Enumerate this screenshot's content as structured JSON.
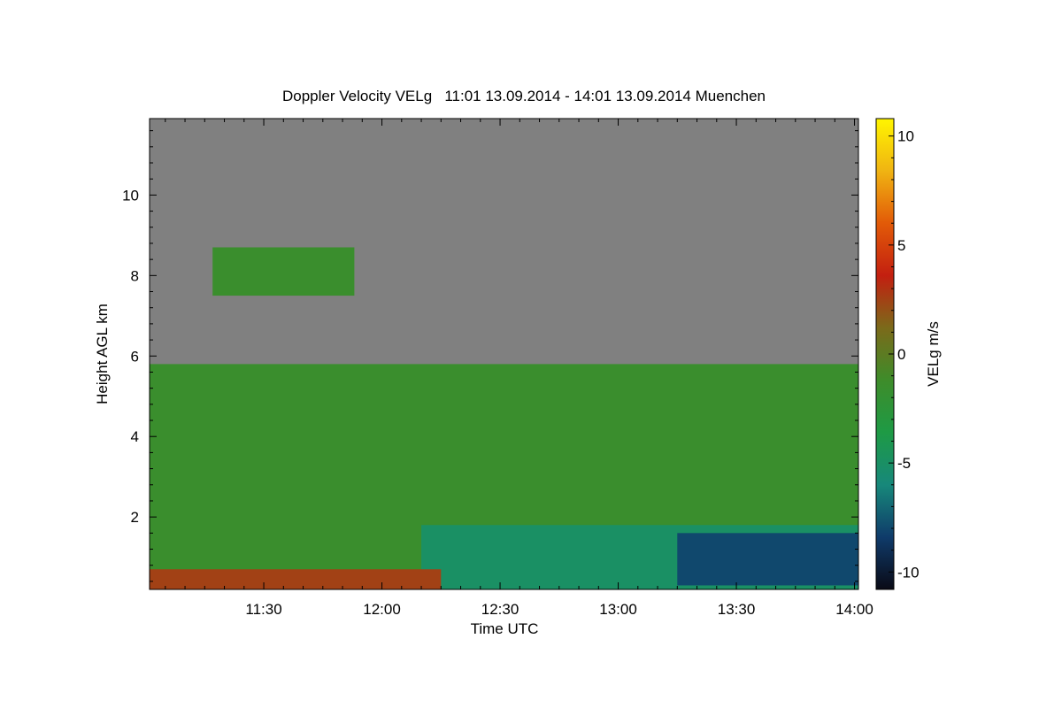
{
  "chart_data": {
    "type": "heatmap",
    "title": "Doppler Velocity VELg   11:01 13.09.2014 - 14:01 13.09.2014 Muenchen",
    "xlabel": "Time UTC",
    "ylabel": "Height AGL km",
    "colorbar_label": "VELg m/s",
    "x_range": [
      "11:01",
      "14:01"
    ],
    "x_ticks": [
      "11:30",
      "12:00",
      "12:30",
      "13:00",
      "13:30",
      "14:00"
    ],
    "y_range_km": [
      0.2,
      11.9
    ],
    "y_ticks": [
      2,
      4,
      6,
      8,
      10
    ],
    "colorbar_range": [
      -10.8,
      10.8
    ],
    "colorbar_ticks": [
      10,
      5,
      0,
      -5,
      -10
    ],
    "colorscale": [
      "#0a0a16",
      "#0f3b6a",
      "#17887a",
      "#1e9a45",
      "#3e8c2a",
      "#7b6a1a",
      "#c31f10",
      "#e25a08",
      "#f0b412",
      "#fff500"
    ],
    "background_color": "#808080",
    "features": [
      {
        "description": "main cloud/precipitation layer",
        "time_start": "11:01",
        "time_end": "14:01",
        "height_base_km": 0.2,
        "height_top_km": 5.8,
        "velocity_ms": -1.5
      },
      {
        "description": "elevated cloud patch",
        "time_start": "11:17",
        "time_end": "11:53",
        "height_base_km": 7.5,
        "height_top_km": 8.7,
        "velocity_ms": -1.5
      },
      {
        "description": "fast downward motion below melting layer",
        "time_start": "12:10",
        "time_end": "14:01",
        "height_base_km": 0.2,
        "height_top_km": 1.8,
        "velocity_ms": -5.0
      },
      {
        "description": "strongest downward motion",
        "time_start": "13:15",
        "time_end": "14:01",
        "height_base_km": 0.3,
        "height_top_km": 1.6,
        "velocity_ms": -8.0
      },
      {
        "description": "positive velocity clutter near ground",
        "time_start": "11:01",
        "time_end": "12:15",
        "height_base_km": 0.2,
        "height_top_km": 0.7,
        "velocity_ms": 2.5
      }
    ]
  }
}
